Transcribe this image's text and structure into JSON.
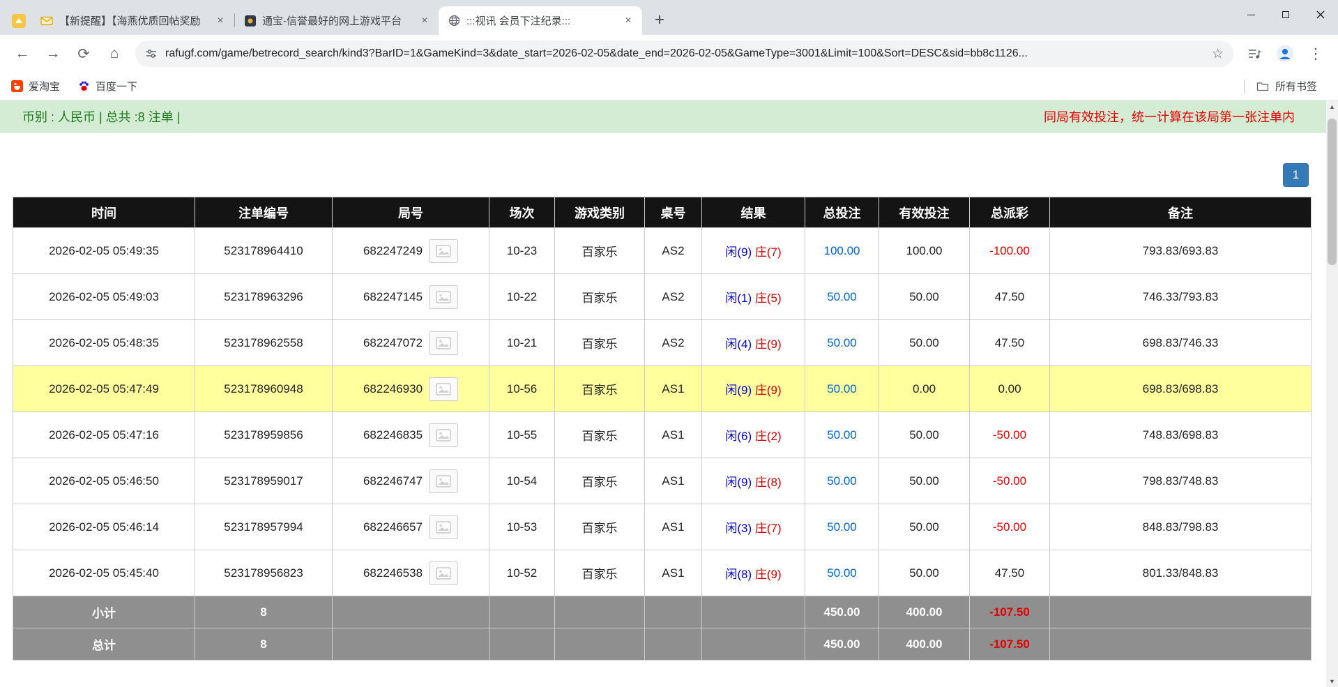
{
  "browser": {
    "tabs": [
      {
        "title": "【新提醒】【海燕优质回帖奖励",
        "favicon": "envelope"
      },
      {
        "title": "通宝-信誉最好的网上游戏平台",
        "favicon": "dark-coin"
      },
      {
        "title": ":::视讯 会员下注纪录:::",
        "favicon": "globe",
        "active": true
      }
    ],
    "url": "rafugf.com/game/betrecord_search/kind3?BarID=1&GameKind=3&date_start=2026-02-05&date_end=2026-02-05&GameType=3001&Limit=100&Sort=DESC&sid=bb8c1126...",
    "bookmarks": [
      {
        "label": "爱淘宝"
      },
      {
        "label": "百度一下"
      }
    ],
    "bookmarks_label": "所有书签"
  },
  "icons": {
    "back": "←",
    "forward": "→",
    "reload": "⟳",
    "home": "⌂",
    "new_tab": "+",
    "menu": "⋮",
    "star": "☆",
    "close_tab": "×",
    "scroll_up": "▲",
    "scroll_down": "▼"
  },
  "page": {
    "info_left": "币别 : 人民币 | 总共 :8 注单 |",
    "info_right": "同局有效投注，统一计算在该局第一张注单内",
    "pagination": "1",
    "table": {
      "headers": [
        "时间",
        "注单编号",
        "局号",
        "场次",
        "游戏类别",
        "桌号",
        "结果",
        "总投注",
        "有效投注",
        "总派彩",
        "备注"
      ],
      "rows": [
        {
          "time": "2026-02-05 05:49:35",
          "bet_id": "523178964410",
          "round": "682247249",
          "session": "10-23",
          "game_type": "百家乐",
          "table_no": "AS2",
          "result_player": "闲(9)",
          "result_banker": "庄(7)",
          "total_bet": "100.00",
          "valid_bet": "100.00",
          "payout": "-100.00",
          "note": "793.83/693.83",
          "highlight": false
        },
        {
          "time": "2026-02-05 05:49:03",
          "bet_id": "523178963296",
          "round": "682247145",
          "session": "10-22",
          "game_type": "百家乐",
          "table_no": "AS2",
          "result_player": "闲(1)",
          "result_banker": "庄(5)",
          "total_bet": "50.00",
          "valid_bet": "50.00",
          "payout": "47.50",
          "note": "746.33/793.83",
          "highlight": false
        },
        {
          "time": "2026-02-05 05:48:35",
          "bet_id": "523178962558",
          "round": "682247072",
          "session": "10-21",
          "game_type": "百家乐",
          "table_no": "AS2",
          "result_player": "闲(4)",
          "result_banker": "庄(9)",
          "total_bet": "50.00",
          "valid_bet": "50.00",
          "payout": "47.50",
          "note": "698.83/746.33",
          "highlight": false
        },
        {
          "time": "2026-02-05 05:47:49",
          "bet_id": "523178960948",
          "round": "682246930",
          "session": "10-56",
          "game_type": "百家乐",
          "table_no": "AS1",
          "result_player": "闲(9)",
          "result_banker": "庄(9)",
          "total_bet": "50.00",
          "valid_bet": "0.00",
          "payout": "0.00",
          "note": "698.83/698.83",
          "highlight": true
        },
        {
          "time": "2026-02-05 05:47:16",
          "bet_id": "523178959856",
          "round": "682246835",
          "session": "10-55",
          "game_type": "百家乐",
          "table_no": "AS1",
          "result_player": "闲(6)",
          "result_banker": "庄(2)",
          "total_bet": "50.00",
          "valid_bet": "50.00",
          "payout": "-50.00",
          "note": "748.83/698.83",
          "highlight": false
        },
        {
          "time": "2026-02-05 05:46:50",
          "bet_id": "523178959017",
          "round": "682246747",
          "session": "10-54",
          "game_type": "百家乐",
          "table_no": "AS1",
          "result_player": "闲(9)",
          "result_banker": "庄(8)",
          "total_bet": "50.00",
          "valid_bet": "50.00",
          "payout": "-50.00",
          "note": "798.83/748.83",
          "highlight": false
        },
        {
          "time": "2026-02-05 05:46:14",
          "bet_id": "523178957994",
          "round": "682246657",
          "session": "10-53",
          "game_type": "百家乐",
          "table_no": "AS1",
          "result_player": "闲(3)",
          "result_banker": "庄(7)",
          "total_bet": "50.00",
          "valid_bet": "50.00",
          "payout": "-50.00",
          "note": "848.83/798.83",
          "highlight": false
        },
        {
          "time": "2026-02-05 05:45:40",
          "bet_id": "523178956823",
          "round": "682246538",
          "session": "10-52",
          "game_type": "百家乐",
          "table_no": "AS1",
          "result_player": "闲(8)",
          "result_banker": "庄(9)",
          "total_bet": "50.00",
          "valid_bet": "50.00",
          "payout": "47.50",
          "note": "801.33/848.83",
          "highlight": false
        }
      ],
      "subtotal": {
        "label": "小计",
        "count": "8",
        "total_bet": "450.00",
        "valid_bet": "400.00",
        "payout": "-107.50"
      },
      "total": {
        "label": "总计",
        "count": "8",
        "total_bet": "450.00",
        "valid_bet": "400.00",
        "payout": "-107.50"
      }
    }
  }
}
